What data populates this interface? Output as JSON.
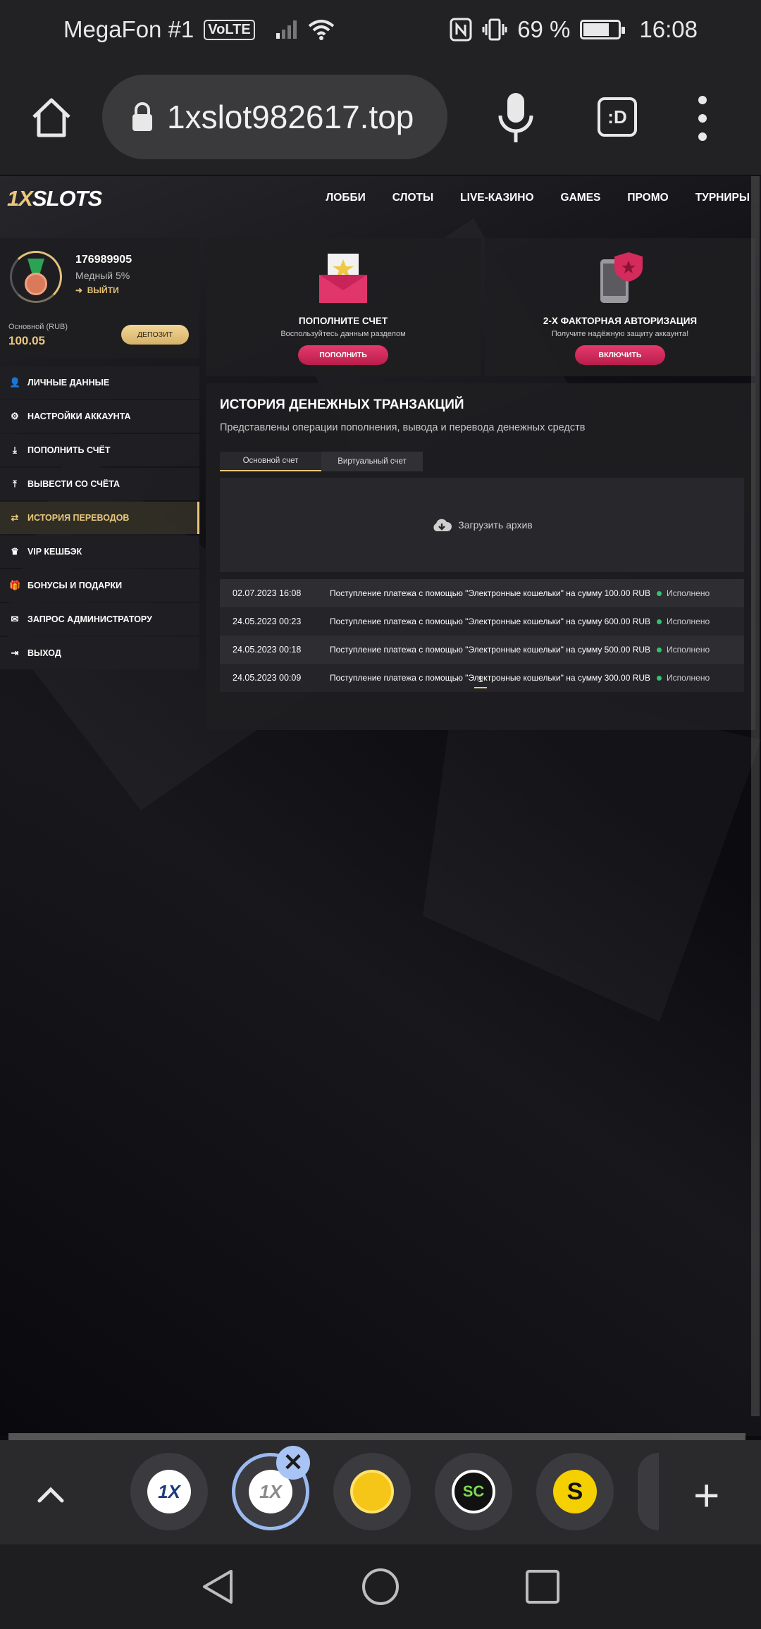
{
  "status_bar": {
    "carrier": "MegaFon #1",
    "volte": "VoLTE",
    "battery": "69 %",
    "battery_level": 0.69,
    "time": "16:08"
  },
  "browser": {
    "url": "1xslot982617.top",
    "tab_switch_label": ":D"
  },
  "site": {
    "logo_prefix": "1X",
    "logo_suffix": "SLOTS",
    "nav": [
      "ЛОББИ",
      "СЛОТЫ",
      "LIVE-КАЗИНО",
      "GAMES",
      "ПРОМО",
      "ТУРНИРЫ"
    ]
  },
  "profile": {
    "user_id": "176989905",
    "rank": "Медный 5%",
    "logout": "ВЫЙТИ",
    "balance_label": "Основной (RUB)",
    "balance": "100.05",
    "deposit_button": "ДЕПОЗИТ"
  },
  "menu": [
    {
      "label": "ЛИЧНЫЕ ДАННЫЕ",
      "icon": "user-plus-icon",
      "glyph": "👤"
    },
    {
      "label": "НАСТРОЙКИ АККАУНТА",
      "icon": "gears-icon",
      "glyph": "⚙"
    },
    {
      "label": "ПОПОЛНИТЬ СЧЁТ",
      "icon": "download-icon",
      "glyph": "⤓"
    },
    {
      "label": "ВЫВЕСТИ СО СЧЁТА",
      "icon": "upload-icon",
      "glyph": "⤒"
    },
    {
      "label": "ИСТОРИЯ ПЕРЕВОДОВ",
      "icon": "transfer-icon",
      "glyph": "⇄",
      "active": true
    },
    {
      "label": "VIP КЕШБЭК",
      "icon": "crown-icon",
      "glyph": "♛"
    },
    {
      "label": "БОНУСЫ И ПОДАРКИ",
      "icon": "gift-icon",
      "glyph": "🎁"
    },
    {
      "label": "ЗАПРОС АДМИНИСТРАТОРУ",
      "icon": "envelope-icon",
      "glyph": "✉"
    },
    {
      "label": "ВЫХОД",
      "icon": "sign-out-icon",
      "glyph": "⇥"
    }
  ],
  "cards": {
    "deposit": {
      "title": "ПОПОЛНИТЕ СЧЕТ",
      "subtitle": "Воспользуйтесь данным разделом",
      "button": "ПОПОЛНИТЬ",
      "icon": "envelope-star-icon"
    },
    "twofa": {
      "title": "2-Х ФАКТОРНАЯ АВТОРИЗАЦИЯ",
      "subtitle": "Получите надёжную защиту аккаунта!",
      "button": "ВКЛЮЧИТЬ",
      "icon": "phone-shield-icon"
    }
  },
  "history": {
    "title": "ИСТОРИЯ ДЕНЕЖНЫХ ТРАНЗАКЦИЙ",
    "subtitle": "Представлены операции пополнения, вывода и перевода денежных средств",
    "tabs": [
      "Основной счет",
      "Виртуальный счет"
    ],
    "archive": "Загрузить архив",
    "rows": [
      {
        "date": "02.07.2023 16:08",
        "desc": "Поступление платежа с помощью \"Электронные кошельки\" на сумму 100.00 RUB",
        "status": "Исполнено"
      },
      {
        "date": "24.05.2023 00:23",
        "desc": "Поступление платежа с помощью \"Электронные кошельки\" на сумму 600.00 RUB",
        "status": "Исполнено"
      },
      {
        "date": "24.05.2023 00:18",
        "desc": "Поступление платежа с помощью \"Электронные кошельки\" на сумму 500.00 RUB",
        "status": "Исполнено"
      },
      {
        "date": "24.05.2023 00:09",
        "desc": "Поступление платежа с помощью \"Электронные кошельки\" на сумму 300.00 RUB",
        "status": "Исполнено"
      }
    ],
    "pager": {
      "prev": "‹",
      "current": "1",
      "next": "›"
    }
  },
  "tab_strip": {
    "tabs": [
      {
        "label": "1X",
        "icon": "1x-tab-icon",
        "bg": "#ffffff",
        "fg": "#1b3a80"
      },
      {
        "label": "1X",
        "icon": "1x-grey-tab-icon",
        "bg": "#ffffff",
        "fg": "#8a8a8a",
        "active": true
      },
      {
        "label": "",
        "icon": "yellow-ball-tab-icon",
        "bg": "#f5c518",
        "fg": "#f5c518"
      },
      {
        "label": "SC",
        "icon": "sc-tab-icon",
        "bg": "#111111",
        "fg": "#7ed957"
      },
      {
        "label": "S",
        "icon": "s-tab-icon",
        "bg": "#f5d000",
        "fg": "#111111"
      }
    ],
    "close": "✕",
    "new_tab": "+"
  },
  "colors": {
    "gold": "#e8c77e",
    "accent_pink": "#d42a5c",
    "status_green": "#34c26c"
  }
}
